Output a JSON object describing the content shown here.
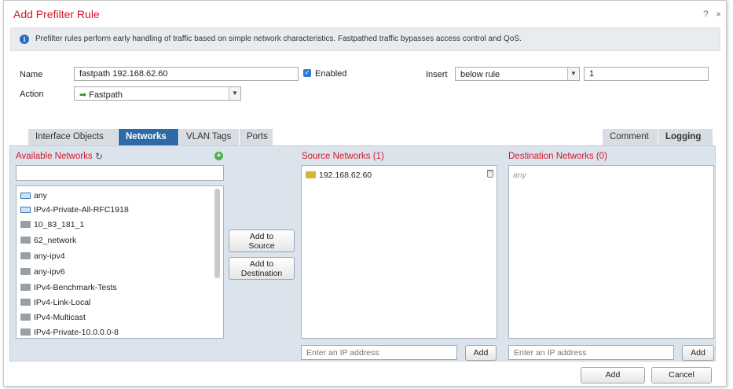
{
  "dialog": {
    "title": "Add Prefilter Rule",
    "help_icon": "?",
    "close_icon": "×"
  },
  "info": {
    "icon": "i",
    "text": "Prefilter rules perform early handling of traffic based on simple network characteristics. Fastpathed traffic bypasses access control and QoS."
  },
  "form": {
    "name_label": "Name",
    "name_value": "fastpath 192.168.62.60",
    "enabled_label": "Enabled",
    "enabled_checked": true,
    "insert_label": "Insert",
    "insert_value": "below rule",
    "insert_number": "1",
    "action_label": "Action",
    "action_value": "Fastpath"
  },
  "tabs": {
    "left": [
      "Interface Objects",
      "Networks",
      "VLAN Tags",
      "Ports"
    ],
    "active": "Networks",
    "right": [
      "Comment",
      "Logging"
    ]
  },
  "available": {
    "title": "Available Networks",
    "search_value": "",
    "items": [
      {
        "label": "any",
        "icon": "network-group-icon"
      },
      {
        "label": "IPv4-Private-All-RFC1918",
        "icon": "network-group-icon"
      },
      {
        "label": "10_83_181_1",
        "icon": "network-object-icon"
      },
      {
        "label": "62_network",
        "icon": "network-object-icon"
      },
      {
        "label": "any-ipv4",
        "icon": "network-object-icon"
      },
      {
        "label": "any-ipv6",
        "icon": "network-object-icon"
      },
      {
        "label": "IPv4-Benchmark-Tests",
        "icon": "network-object-icon"
      },
      {
        "label": "IPv4-Link-Local",
        "icon": "network-object-icon"
      },
      {
        "label": "IPv4-Multicast",
        "icon": "network-object-icon"
      },
      {
        "label": "IPv4-Private-10.0.0.0-8",
        "icon": "network-object-icon"
      }
    ]
  },
  "buttons": {
    "add_to_source": [
      "Add to",
      "Source"
    ],
    "add_to_destination": [
      "Add to",
      "Destination"
    ],
    "add_source_ip": "Add",
    "add_dest_ip": "Add",
    "add": "Add",
    "cancel": "Cancel"
  },
  "source": {
    "title": "Source Networks (1)",
    "items": [
      "192.168.62.60"
    ],
    "ip_placeholder": "Enter an IP address"
  },
  "destination": {
    "title": "Destination Networks (0)",
    "empty_text": "any",
    "ip_placeholder": "Enter an IP address"
  },
  "colors": {
    "title_red": "#d4182a",
    "tab_active": "#2c6aa8",
    "panel_bg": "#dbe3ec"
  }
}
